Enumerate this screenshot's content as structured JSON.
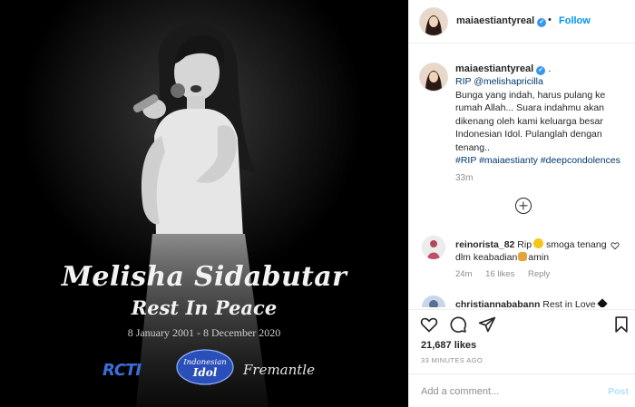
{
  "post": {
    "image": {
      "memorial_name": "Melisha Sidabutar",
      "memorial_subtitle": "Rest In Peace",
      "memorial_dates": "8 January 2001  - 8 December 2020",
      "logos": {
        "rcti": "RCTI",
        "idol_line1": "Indonesian",
        "idol_line2": "Idol",
        "fremantle": "Fremantle"
      }
    },
    "header": {
      "username": "maiaestiantyreal",
      "separator": "•",
      "follow_label": "Follow"
    },
    "caption": {
      "username": "maiaestiantyreal",
      "trailing_dot": ".",
      "mention": "RIP @melishapricilla",
      "body": "Bunga yang indah, harus pulang ke rumah Allah... Suara indahmu akan dikenang oleh kami keluarga besar Indonesian Idol. Pulanglah dengan tenang..",
      "hashtags": "#RIP #maiaestianty #deepcondolences",
      "time": "33m"
    },
    "comments": [
      {
        "username": "reinorista_82",
        "text_before": "Rip",
        "text_after": " smoga tenang dlm keabadian",
        "text_end": "amin",
        "time": "24m",
        "likes": "16 likes",
        "reply": "Reply"
      },
      {
        "username": "christiannababann",
        "text": "Rest in Love"
      }
    ],
    "likes_count": "21,687 likes",
    "posted_ago": "33 MINUTES AGO",
    "add_comment_placeholder": "Add a comment...",
    "post_label": "Post"
  },
  "colors": {
    "accent": "#0095f6",
    "verified": "#3897f0",
    "link": "#00376b",
    "muted": "#8e8e8e"
  },
  "icons": [
    "heart-icon",
    "comment-icon",
    "share-icon",
    "bookmark-icon",
    "plus-circle-icon",
    "verified-icon"
  ]
}
